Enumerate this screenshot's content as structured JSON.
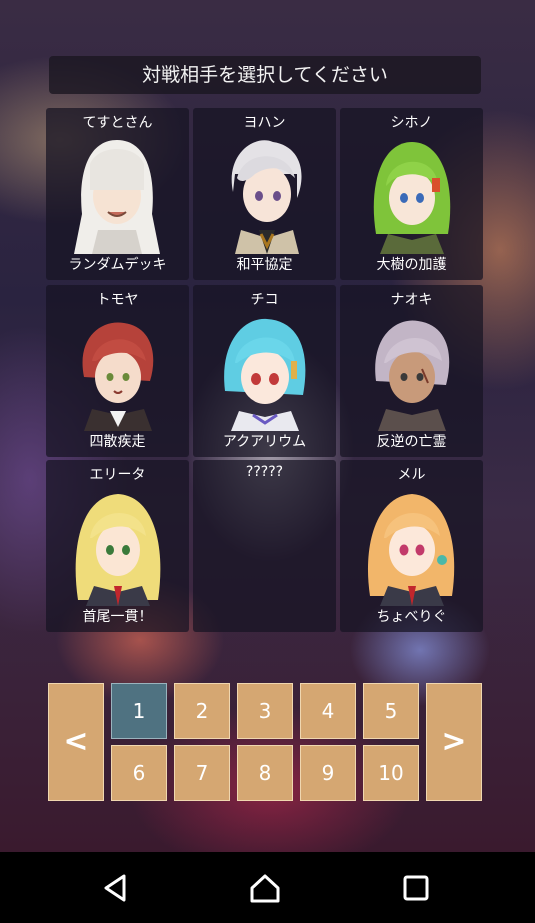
{
  "header": {
    "title": "対戦相手を選択してください"
  },
  "opponents": [
    {
      "name": "てすとさん",
      "deck": "ランダムデッキ",
      "icon": "hooded-character-portrait",
      "hair": "#e9e7e4",
      "accent": "#cfcac3"
    },
    {
      "name": "ヨハン",
      "deck": "和平協定",
      "icon": "silver-haired-character-portrait",
      "hair": "#e4e2e6",
      "accent": "#a8761f"
    },
    {
      "name": "シホノ",
      "deck": "大樹の加護",
      "icon": "green-haired-character-portrait",
      "hair": "#7fc43a",
      "accent": "#d9502b"
    },
    {
      "name": "トモヤ",
      "deck": "四散疾走",
      "icon": "red-haired-character-portrait",
      "hair": "#b6423a",
      "accent": "#3a3030"
    },
    {
      "name": "チコ",
      "deck": "アクアリウム",
      "icon": "cyan-haired-character-portrait",
      "hair": "#5fcde3",
      "accent": "#e9e9ef"
    },
    {
      "name": "ナオキ",
      "deck": "反逆の亡霊",
      "icon": "lavender-haired-character-portrait",
      "hair": "#c2b5c6",
      "accent": "#5b4f4c"
    },
    {
      "name": "エリータ",
      "deck": "首尾一貫！",
      "icon": "blonde-haired-character-portrait",
      "hair": "#efdc7a",
      "accent": "#c2262c"
    },
    {
      "name": "?????",
      "deck": "",
      "icon": "locked-slot",
      "hair": "",
      "accent": ""
    },
    {
      "name": "メル",
      "deck": "ちょべりぐ",
      "icon": "orange-haired-character-portrait",
      "hair": "#f2b66a",
      "accent": "#c2262c"
    }
  ],
  "pager": {
    "prev_label": "<",
    "next_label": ">",
    "pages": [
      "1",
      "2",
      "3",
      "4",
      "5",
      "6",
      "7",
      "8",
      "9",
      "10"
    ],
    "current_page": 1
  },
  "navbar": {
    "icons": [
      "back-triangle-icon",
      "home-icon",
      "recents-square-icon"
    ]
  }
}
